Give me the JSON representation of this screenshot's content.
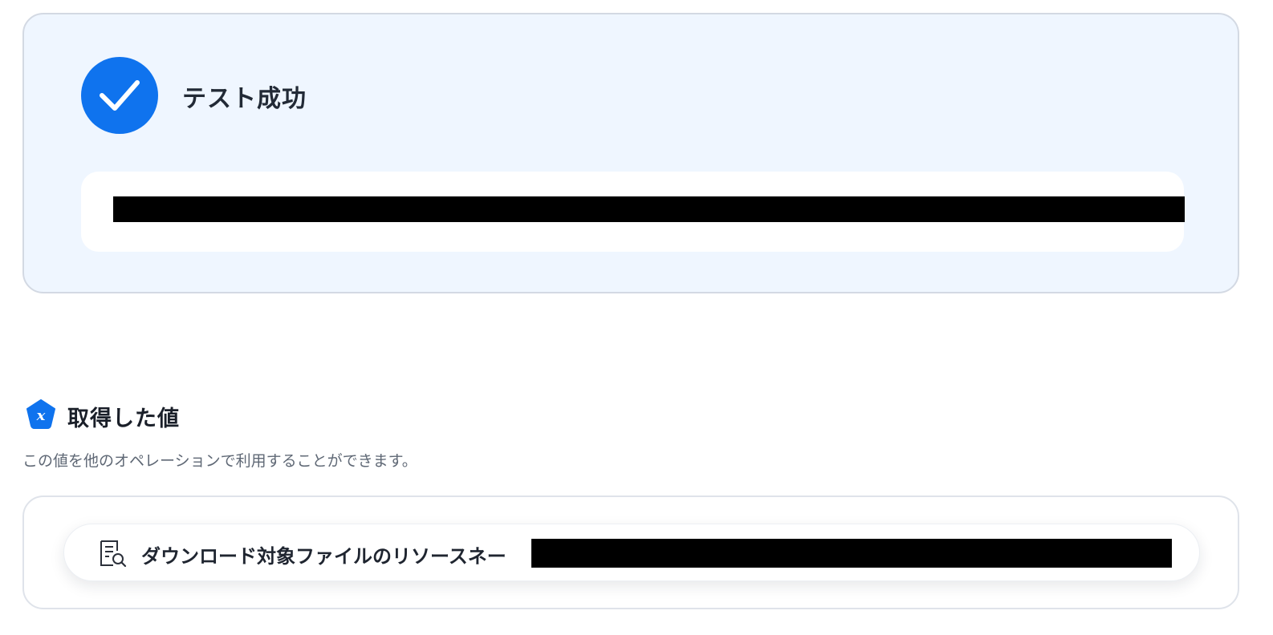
{
  "test_result": {
    "title": "テスト成功",
    "icon": "check-circle-icon",
    "status_color": "#0f73ee",
    "message": ""
  },
  "obtained_values": {
    "icon": "variable-pentagon-icon",
    "title": "取得した値",
    "description": "この値を他のオペレーションで利用することができます。",
    "items": [
      {
        "icon": "document-search-icon",
        "label": "ダウンロード対象ファイルのリソースネー",
        "value": ""
      }
    ]
  },
  "colors": {
    "accent": "#0f73ee",
    "panel_bg": "#eff6ff",
    "panel_border": "#d3d9e3",
    "text_primary": "#222a36",
    "text_secondary": "#5f6875"
  }
}
